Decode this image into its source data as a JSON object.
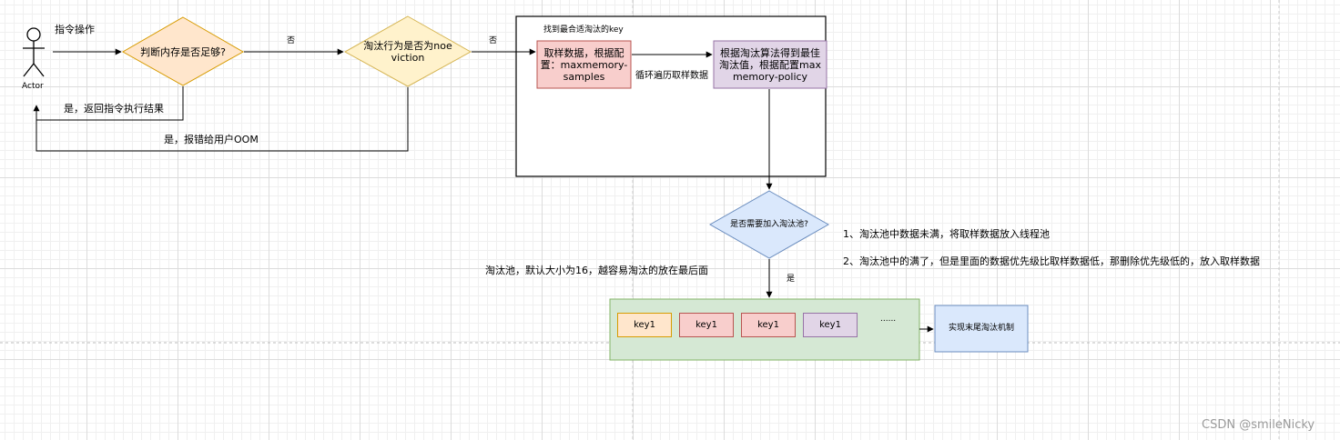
{
  "actor": {
    "label": "Actor"
  },
  "labels": {
    "command_op": "指令操作",
    "no_1": "否",
    "no_2": "否",
    "yes_return": "是，返回指令执行结果",
    "yes_oom": "是，报错给用户OOM",
    "container_title": "找到最合适淘汰的key",
    "loop_sample": "循环遍历取样数据",
    "yes_pool": "是",
    "pool_desc": "淘汰池，默认大小为16，越容易淘汰的放在最后面",
    "note_1": "1、淘汰池中数据未满，将取样数据放入线程池",
    "note_2": "2、淘汰池中的满了，但是里面的数据优先级比取样数据低，那删除优先级低的，放入取样数据"
  },
  "nodes": {
    "memory_check": "判断内存是否足够?",
    "eviction_policy": "淘汰行为是否为noeviction",
    "sample_data": "取样数据，根据配置：maxmemory-samples",
    "best_value": "根据淘汰算法得到最佳淘汰值，根据配置maxmemory-policy",
    "join_pool": "是否需要加入淘汰池?",
    "lru_result": "实现末尾淘汰机制"
  },
  "pool": {
    "keys": [
      {
        "label": "key1",
        "fill": "#ffe6cc",
        "stroke": "#d79b00"
      },
      {
        "label": "key1",
        "fill": "#f8cecc",
        "stroke": "#b85450"
      },
      {
        "label": "key1",
        "fill": "#f8cecc",
        "stroke": "#b85450"
      },
      {
        "label": "key1",
        "fill": "#e1d5e7",
        "stroke": "#9673a6"
      }
    ],
    "ellipsis": "......"
  },
  "colors": {
    "orange_fill": "#ffe6cc",
    "orange_stroke": "#d79b00",
    "yellow_fill": "#fff2cc",
    "yellow_stroke": "#d6b656",
    "red_fill": "#f8cecc",
    "red_stroke": "#b85450",
    "purple_fill": "#e1d5e7",
    "purple_stroke": "#9673a6",
    "blue_fill": "#dae8fc",
    "blue_stroke": "#6c8ebf",
    "green_fill": "#d5e8d4",
    "green_stroke": "#82b366"
  },
  "watermark": "CSDN @smileNicky"
}
